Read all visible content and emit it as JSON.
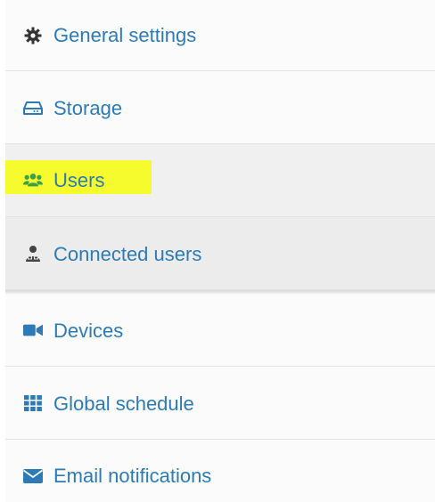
{
  "menu": {
    "items": [
      {
        "label": "General settings",
        "icon": "gear-icon"
      },
      {
        "label": "Storage",
        "icon": "hard-drive-icon"
      },
      {
        "label": "Users",
        "icon": "users-icon"
      },
      {
        "label": "Connected users",
        "icon": "connected-user-icon"
      },
      {
        "label": "Devices",
        "icon": "video-camera-icon"
      },
      {
        "label": "Global schedule",
        "icon": "grid-icon"
      },
      {
        "label": "Email notifications",
        "icon": "envelope-icon"
      }
    ]
  },
  "colors": {
    "link": "#2c7bb6",
    "highlight": "#f6fb2e",
    "row_white": "#fbfbfb",
    "row_gray": "#f0f0f0",
    "row_sub": "#ececec",
    "border": "#e3e3e3"
  }
}
